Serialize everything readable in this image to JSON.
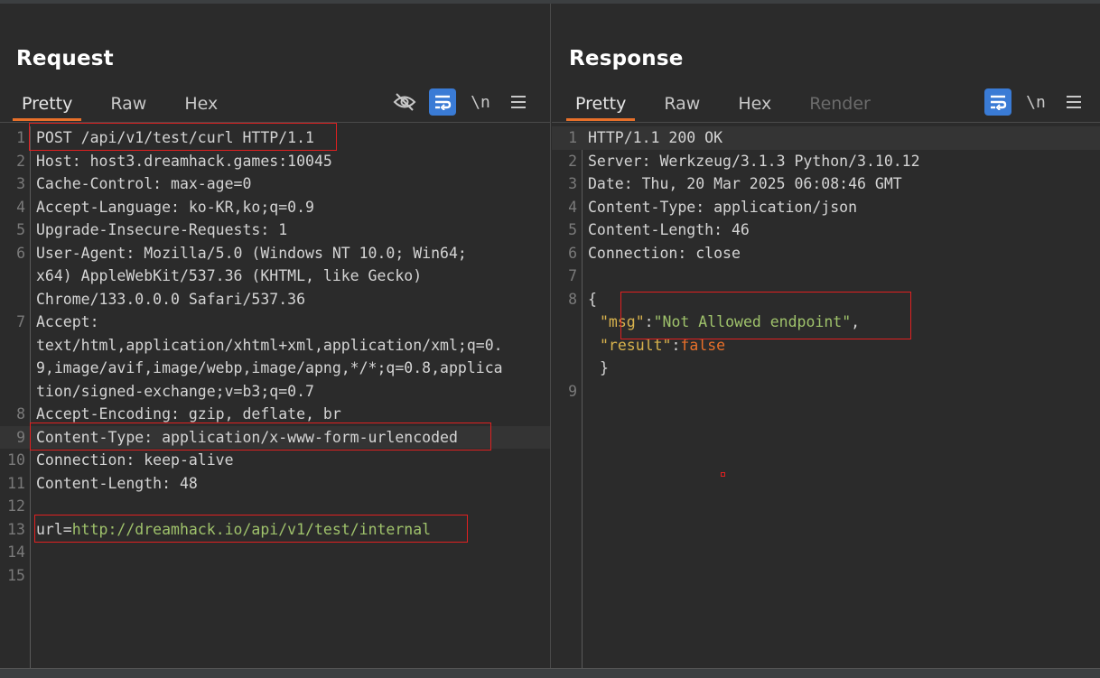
{
  "layout_toggle": [
    "split-vertical",
    "split-horizontal",
    "single"
  ],
  "request": {
    "title": "Request",
    "tabs": [
      "Pretty",
      "Raw",
      "Hex"
    ],
    "active_tab": "Pretty",
    "icons": [
      "eye-slash-icon",
      "wrap-icon",
      "newline-icon",
      "menu-icon"
    ],
    "newline_label": "\\n",
    "lines": [
      {
        "n": "1",
        "text": "POST /api/v1/test/curl HTTP/1.1"
      },
      {
        "n": "2",
        "text": "Host: host3.dreamhack.games:10045"
      },
      {
        "n": "3",
        "text": "Cache-Control: max-age=0"
      },
      {
        "n": "4",
        "text": "Accept-Language: ko-KR,ko;q=0.9"
      },
      {
        "n": "5",
        "text": "Upgrade-Insecure-Requests: 1"
      },
      {
        "n": "6",
        "text": "User-Agent: Mozilla/5.0 (Windows NT 10.0; Win64;"
      },
      {
        "n": "",
        "text": "x64) AppleWebKit/537.36 (KHTML, like Gecko)"
      },
      {
        "n": "",
        "text": "Chrome/133.0.0.0 Safari/537.36"
      },
      {
        "n": "7",
        "text": "Accept:"
      },
      {
        "n": "",
        "text": "text/html,application/xhtml+xml,application/xml;q=0."
      },
      {
        "n": "",
        "text": "9,image/avif,image/webp,image/apng,*/*;q=0.8,applica"
      },
      {
        "n": "",
        "text": "tion/signed-exchange;v=b3;q=0.7"
      },
      {
        "n": "8",
        "text": "Accept-Encoding: gzip, deflate, br"
      },
      {
        "n": "9",
        "text": "Content-Type: application/x-www-form-urlencoded"
      },
      {
        "n": "10",
        "text": "Connection: keep-alive"
      },
      {
        "n": "11",
        "text": "Content-Length: 48"
      },
      {
        "n": "12",
        "text": ""
      },
      {
        "n": "13",
        "text": "url=",
        "url": "http://dreamhack.io/api/v1/test/internal"
      },
      {
        "n": "14",
        "text": ""
      },
      {
        "n": "15",
        "text": ""
      }
    ]
  },
  "response": {
    "title": "Response",
    "tabs": [
      "Pretty",
      "Raw",
      "Hex",
      "Render"
    ],
    "active_tab": "Pretty",
    "icons": [
      "wrap-icon",
      "newline-icon",
      "menu-icon"
    ],
    "newline_label": "\\n",
    "lines": [
      {
        "n": "1",
        "text": "HTTP/1.1 200 OK"
      },
      {
        "n": "2",
        "text": "Server: Werkzeug/3.1.3 Python/3.10.12"
      },
      {
        "n": "3",
        "text": "Date: Thu, 20 Mar 2025 06:08:46 GMT"
      },
      {
        "n": "4",
        "text": "Content-Type: application/json"
      },
      {
        "n": "5",
        "text": "Content-Length: 46"
      },
      {
        "n": "6",
        "text": "Connection: close"
      },
      {
        "n": "7",
        "text": ""
      },
      {
        "n": "8",
        "text": "{"
      },
      {
        "n": "",
        "json": [
          "\"msg\"",
          ":",
          "\"Not Allowed endpoint\"",
          ","
        ]
      },
      {
        "n": "",
        "json2": [
          "\"result\"",
          ":",
          "false"
        ]
      },
      {
        "n": "",
        "text": "}"
      },
      {
        "n": "9",
        "text": ""
      }
    ]
  }
}
